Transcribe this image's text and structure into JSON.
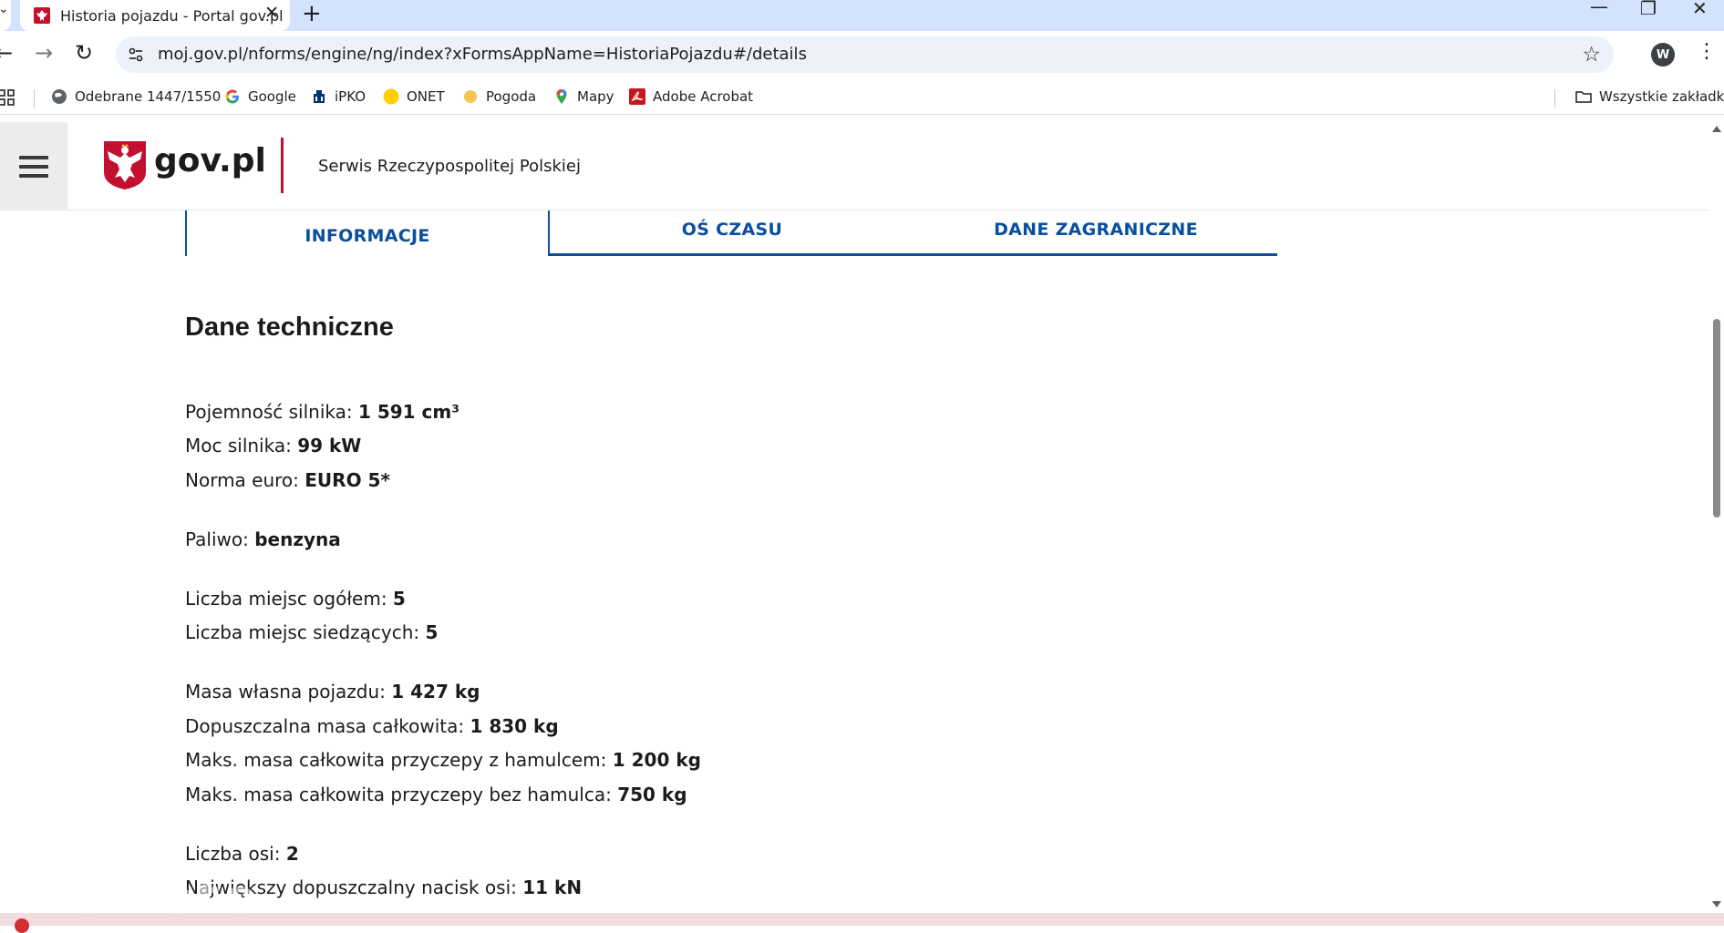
{
  "browser": {
    "tab_title": "Historia pojazdu - Portal gov.pl",
    "tab_close": "✕",
    "new_tab": "+",
    "url": "moj.gov.pl/nforms/engine/ng/index?xFormsAppName=HistoriaPojazdu#/details",
    "profile_initial": "W",
    "bookmarks": [
      {
        "label": "Odebrane 1447/1550",
        "icon": "globe-icon"
      },
      {
        "label": "Google",
        "icon": "google-icon"
      },
      {
        "label": "iPKO",
        "icon": "pko-icon"
      },
      {
        "label": "ONET",
        "icon": "onet-icon"
      },
      {
        "label": "Pogoda",
        "icon": "weather-icon"
      },
      {
        "label": "Mapy",
        "icon": "maps-pin-icon"
      },
      {
        "label": "Adobe Acrobat",
        "icon": "acrobat-icon"
      }
    ],
    "all_bookmarks": "Wszystkie zakładki"
  },
  "header": {
    "logo_text": "gov.pl",
    "service_name": "Serwis Rzeczypospolitej Polskiej",
    "accent_color": "#c3102f"
  },
  "tabs": [
    {
      "label": "INFORMACJE",
      "active": true
    },
    {
      "label": "OŚ CZASU",
      "active": false
    },
    {
      "label": "DANE ZAGRANICZNE",
      "active": false
    }
  ],
  "section": {
    "title": "Dane techniczne",
    "rows": [
      {
        "label": "Pojemność silnika: ",
        "value": "1 591 cm³"
      },
      {
        "label": "Moc silnika: ",
        "value": "99 kW"
      },
      {
        "label": "Norma euro: ",
        "value": "EURO 5*"
      },
      {
        "label": "Paliwo: ",
        "value": "benzyna"
      },
      {
        "label": "Liczba miejsc ogółem: ",
        "value": "5"
      },
      {
        "label": "Liczba miejsc siedzących: ",
        "value": "5"
      },
      {
        "label": "Masa własna pojazdu: ",
        "value": "1 427 kg"
      },
      {
        "label": "Dopuszczalna masa całkowita: ",
        "value": "1 830 kg"
      },
      {
        "label": "Maks. masa całkowita przyczepy z hamulcem: ",
        "value": "1 200 kg"
      },
      {
        "label": "Maks. masa całkowita przyczepy bez hamulca: ",
        "value": "750 kg"
      },
      {
        "label": "Liczba osi: ",
        "value": "2"
      },
      {
        "label": "Największy dopuszczalny nacisk osi: ",
        "value": "11 kN"
      }
    ]
  },
  "theme": {
    "link_blue": "#0a4f9e",
    "tabstrip_bg": "#d3e3fd"
  },
  "watermark": "otomoto"
}
